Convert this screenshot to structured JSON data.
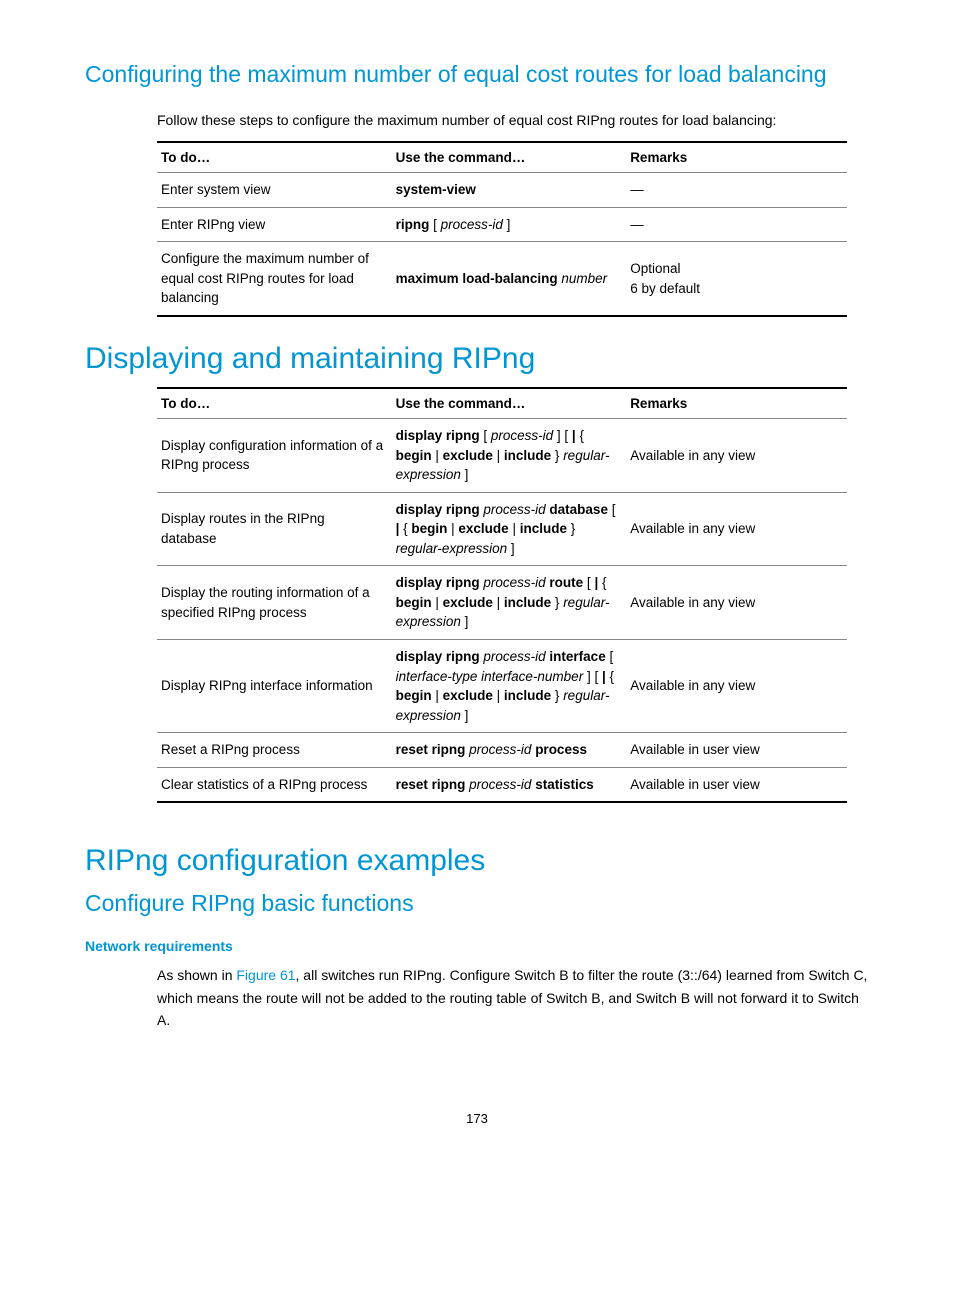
{
  "section1": {
    "heading": "Configuring the maximum number of equal cost routes for load balancing",
    "intro": "Follow these steps to configure the maximum number of equal cost RIPng routes for load balancing:",
    "headers": {
      "todo": "To do…",
      "cmd": "Use the command…",
      "rem": "Remarks"
    },
    "rows": [
      {
        "todo": "Enter system view",
        "cmd": [
          {
            "t": "system-view",
            "b": true
          }
        ],
        "rem": "—"
      },
      {
        "todo": "Enter RIPng view",
        "cmd": [
          {
            "t": "ripng",
            "b": true
          },
          {
            "t": " [ "
          },
          {
            "t": "process-id",
            "i": true
          },
          {
            "t": " ]"
          }
        ],
        "rem": "—"
      },
      {
        "todo": "Configure the maximum number of equal cost RIPng routes for load balancing",
        "cmd": [
          {
            "t": "maximum load-balancing",
            "b": true
          },
          {
            "t": " "
          },
          {
            "t": "number",
            "i": true
          }
        ],
        "rem": "Optional\n6 by default"
      }
    ]
  },
  "section2": {
    "heading": "Displaying and maintaining RIPng",
    "headers": {
      "todo": "To do…",
      "cmd": "Use the command…",
      "rem": "Remarks"
    },
    "rows": [
      {
        "todo": "Display configuration information of a RIPng process",
        "cmd": [
          {
            "t": "display ripng",
            "b": true
          },
          {
            "t": " [ "
          },
          {
            "t": "process-id",
            "i": true
          },
          {
            "t": " ] [ "
          },
          {
            "t": "|",
            "b": true
          },
          {
            "t": " { "
          },
          {
            "t": "begin",
            "b": true
          },
          {
            "t": " | "
          },
          {
            "t": "exclude",
            "b": true
          },
          {
            "t": " | "
          },
          {
            "t": "include",
            "b": true
          },
          {
            "t": " } "
          },
          {
            "t": "regular-expression",
            "i": true
          },
          {
            "t": " ]"
          }
        ],
        "rem": "Available in any view"
      },
      {
        "todo": "Display routes in the RIPng database",
        "cmd": [
          {
            "t": "display ripng",
            "b": true
          },
          {
            "t": " "
          },
          {
            "t": "process-id",
            "i": true
          },
          {
            "t": " "
          },
          {
            "t": "database",
            "b": true
          },
          {
            "t": " [ "
          },
          {
            "t": "|",
            "b": true
          },
          {
            "t": " { "
          },
          {
            "t": "begin",
            "b": true
          },
          {
            "t": " | "
          },
          {
            "t": "exclude",
            "b": true
          },
          {
            "t": " | "
          },
          {
            "t": "include",
            "b": true
          },
          {
            "t": " } "
          },
          {
            "t": "regular-expression",
            "i": true
          },
          {
            "t": " ]"
          }
        ],
        "rem": "Available in any view"
      },
      {
        "todo": "Display the routing information of a specified RIPng process",
        "cmd": [
          {
            "t": "display ripng",
            "b": true
          },
          {
            "t": " "
          },
          {
            "t": "process-id",
            "i": true
          },
          {
            "t": " "
          },
          {
            "t": "route",
            "b": true
          },
          {
            "t": " [ "
          },
          {
            "t": "|",
            "b": true
          },
          {
            "t": " { "
          },
          {
            "t": "begin",
            "b": true
          },
          {
            "t": " | "
          },
          {
            "t": "exclude",
            "b": true
          },
          {
            "t": " | "
          },
          {
            "t": "include",
            "b": true
          },
          {
            "t": " } "
          },
          {
            "t": "regular-expression",
            "i": true
          },
          {
            "t": " ]"
          }
        ],
        "rem": "Available in any view"
      },
      {
        "todo": "Display RIPng interface information",
        "cmd": [
          {
            "t": "display ripng",
            "b": true
          },
          {
            "t": " "
          },
          {
            "t": "process-id",
            "i": true
          },
          {
            "t": " "
          },
          {
            "t": "interface",
            "b": true
          },
          {
            "t": " [ "
          },
          {
            "t": "interface-type interface-number",
            "i": true
          },
          {
            "t": " ] [ "
          },
          {
            "t": "|",
            "b": true
          },
          {
            "t": " { "
          },
          {
            "t": "begin",
            "b": true
          },
          {
            "t": " | "
          },
          {
            "t": "exclude",
            "b": true
          },
          {
            "t": " | "
          },
          {
            "t": "include",
            "b": true
          },
          {
            "t": " } "
          },
          {
            "t": "regular-expression",
            "i": true
          },
          {
            "t": " ]"
          }
        ],
        "rem": "Available in any view"
      },
      {
        "todo": "Reset a RIPng process",
        "cmd": [
          {
            "t": "reset ripng",
            "b": true
          },
          {
            "t": " "
          },
          {
            "t": "process-id",
            "i": true
          },
          {
            "t": " "
          },
          {
            "t": "process",
            "b": true
          }
        ],
        "rem": "Available in user view"
      },
      {
        "todo": "Clear statistics of a RIPng process",
        "cmd": [
          {
            "t": "reset ripng",
            "b": true
          },
          {
            "t": " "
          },
          {
            "t": "process-id",
            "i": true
          },
          {
            "t": " "
          },
          {
            "t": "statistics",
            "b": true
          }
        ],
        "rem": "Available in user view"
      }
    ]
  },
  "section3": {
    "heading": "RIPng configuration examples",
    "subheading": "Configure RIPng basic functions",
    "req_heading": "Network requirements",
    "body_pre": "As shown in ",
    "body_link": "Figure 61",
    "body_post": ", all switches run RIPng. Configure Switch B to filter the route (3::/64) learned from Switch C, which means the route will not be added to the routing table of Switch B, and Switch B will not forward it to Switch A."
  },
  "page_number": "173"
}
